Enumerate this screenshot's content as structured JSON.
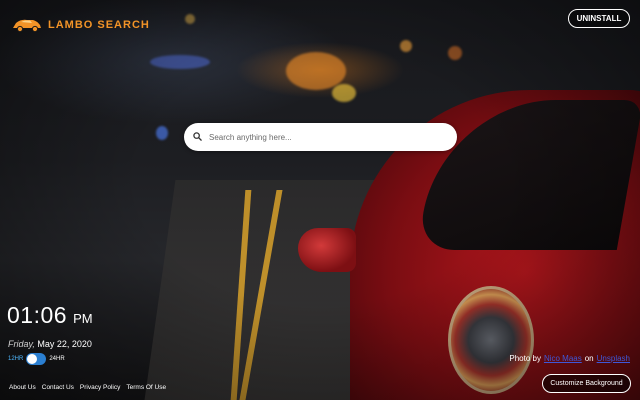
{
  "brand": {
    "name": "LAMBO SEARCH",
    "color": "#f29327"
  },
  "header": {
    "uninstall_label": "UNINSTALL"
  },
  "search": {
    "placeholder": "Search anything here...",
    "value": "",
    "icon": "search-icon"
  },
  "clock": {
    "time": "01:06",
    "ampm": "PM",
    "weekday": "Friday,",
    "date": "May 22, 2020",
    "format_12": "12HR",
    "format_24": "24HR",
    "format_selected": "12HR"
  },
  "footer": {
    "links": [
      "About Us",
      "Contact Us",
      "Privacy Policy",
      "Terms Of Use"
    ]
  },
  "credit": {
    "prefix": "Photo by",
    "author": "Nico Maas",
    "on": "on",
    "source": "Unsplash",
    "link_color": "#3f57d8"
  },
  "customize_label": "Customize Background"
}
